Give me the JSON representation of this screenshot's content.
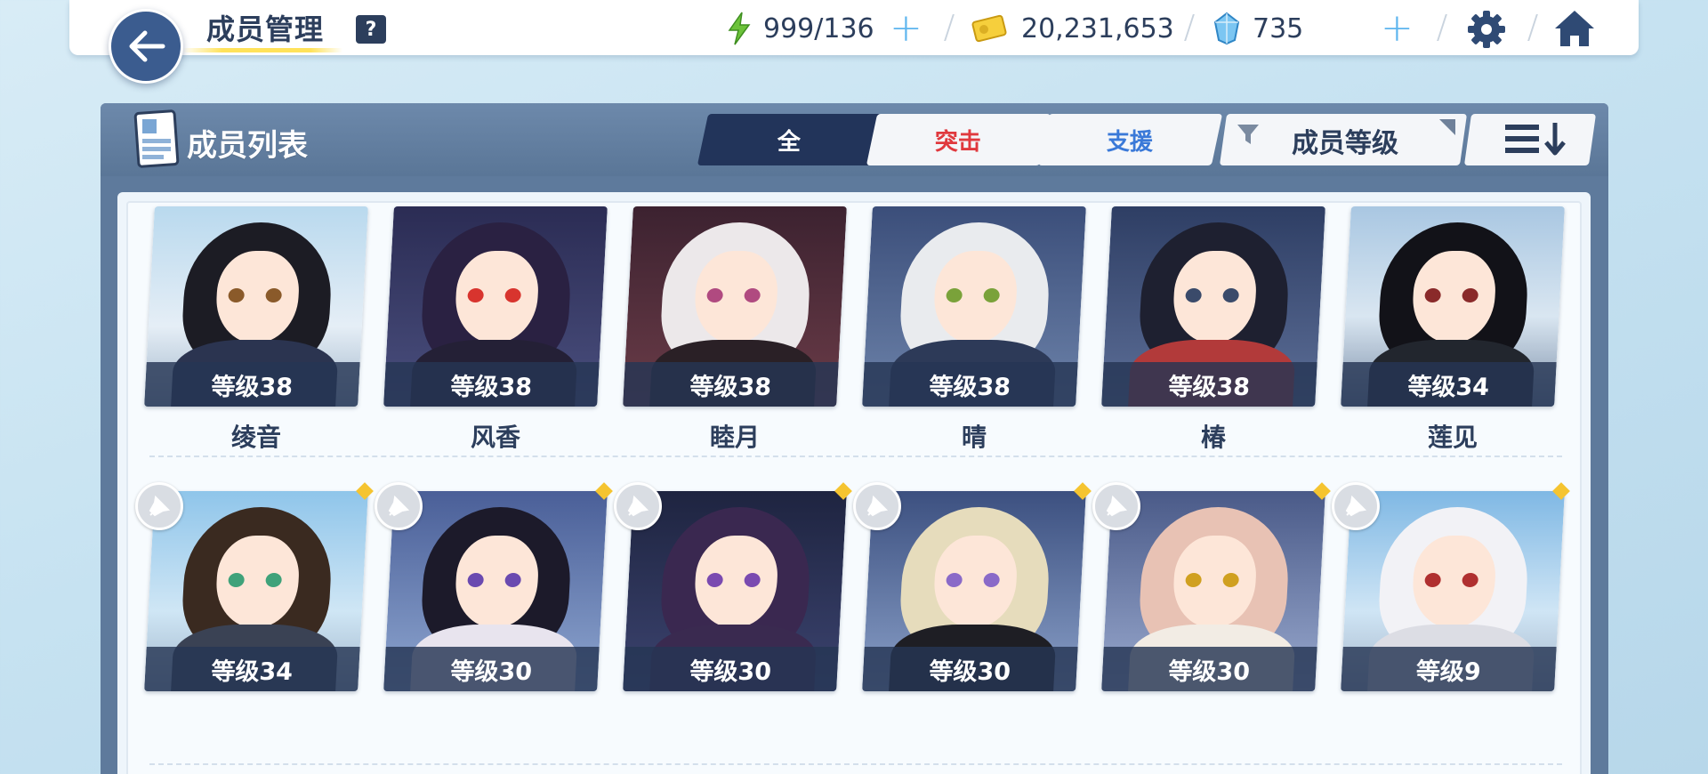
{
  "header": {
    "title": "成员管理",
    "help_label": "?",
    "resources": [
      {
        "icon": "energy-bolt-icon",
        "value": "999/136"
      },
      {
        "icon": "credit-card-icon",
        "value": "20,231,653"
      },
      {
        "icon": "pyroxene-gem-icon",
        "value": "735"
      }
    ]
  },
  "panel": {
    "title": "成员列表",
    "tabs": [
      {
        "label": "全",
        "active": true
      },
      {
        "label": "突击",
        "color": "#e0393e"
      },
      {
        "label": "支援",
        "color": "#3a79d8"
      }
    ],
    "sort_label": "成员等级"
  },
  "members_row1": [
    {
      "name": "绫音",
      "level": "等级38"
    },
    {
      "name": "风香",
      "level": "等级38"
    },
    {
      "name": "睦月",
      "level": "等级38"
    },
    {
      "name": "晴",
      "level": "等级38"
    },
    {
      "name": "椿",
      "level": "等级38"
    },
    {
      "name": "莲见",
      "level": "等级34"
    }
  ],
  "members_row2": [
    {
      "level": "等级34"
    },
    {
      "level": "等级30"
    },
    {
      "level": "等级30"
    },
    {
      "level": "等级30"
    },
    {
      "level": "等级30"
    },
    {
      "level": "等级9"
    }
  ],
  "colors": {
    "accent_dark": "#22345a",
    "strike_red": "#e0393e",
    "support_blue": "#3a79d8",
    "level_bar": "#263654"
  }
}
